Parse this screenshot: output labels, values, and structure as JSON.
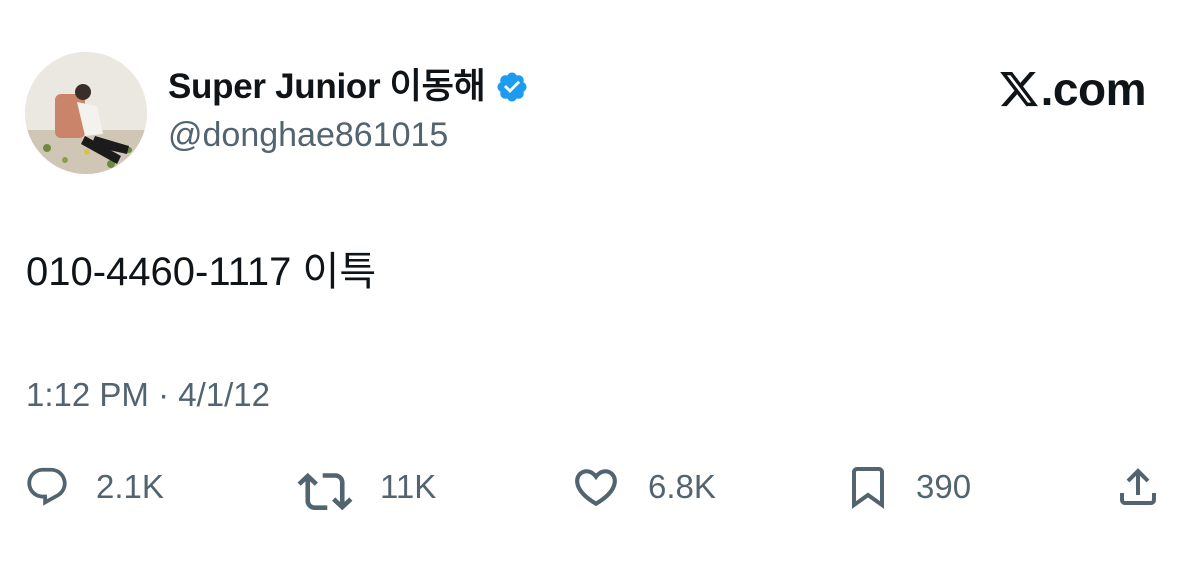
{
  "header": {
    "display_name": "Super Junior 이동해",
    "handle": "@donghae861015",
    "verified": true,
    "verified_color": "#1d9bf0",
    "brand_domain": ".com",
    "brand_icon": "x-logo-icon"
  },
  "tweet": {
    "text": "010-4460-1117 이특",
    "timestamp": "1:12 PM · 4/1/12"
  },
  "actions": {
    "reply": {
      "icon": "reply-icon",
      "count": "2.1K"
    },
    "retweet": {
      "icon": "retweet-icon",
      "count": "11K"
    },
    "like": {
      "icon": "heart-icon",
      "count": "6.8K"
    },
    "bookmark": {
      "icon": "bookmark-icon",
      "count": "390"
    },
    "share": {
      "icon": "share-icon"
    }
  },
  "colors": {
    "text_primary": "#0f1419",
    "text_secondary": "#536471",
    "verified": "#1d9bf0"
  }
}
